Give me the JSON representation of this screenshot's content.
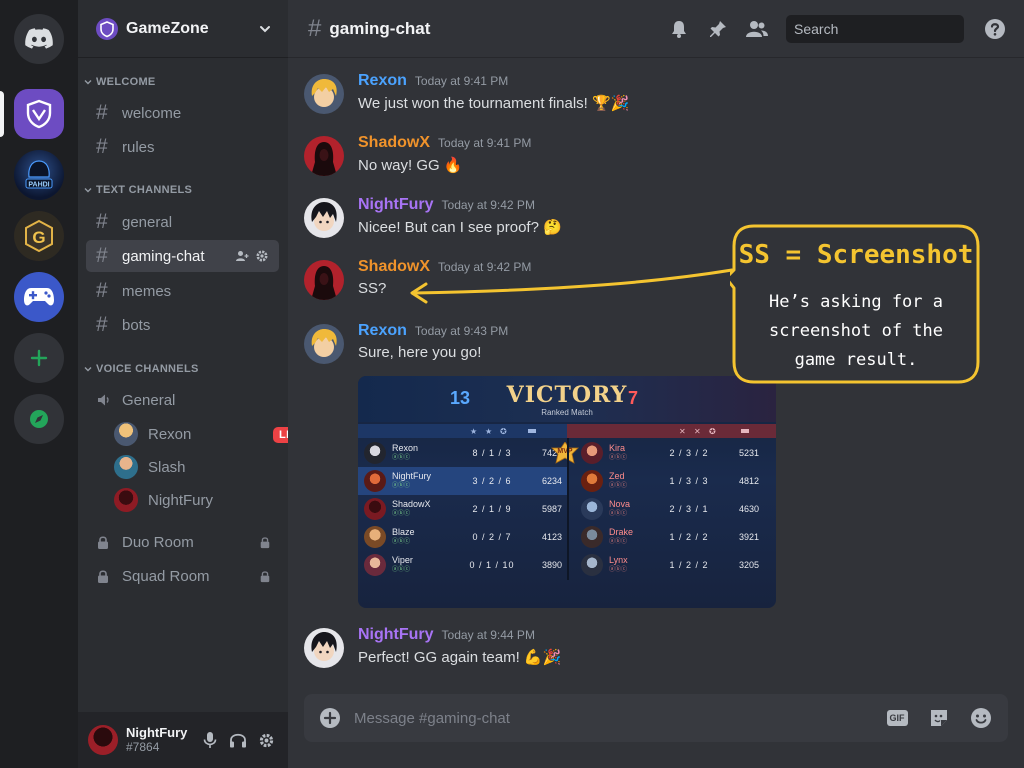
{
  "server": {
    "name": "GameZone"
  },
  "categories": {
    "welcome": "WELCOME",
    "text": "TEXT CHANNELS",
    "voice": "VOICE CHANNELS"
  },
  "channels": {
    "welcome": "welcome",
    "rules": "rules",
    "general": "general",
    "gaming_chat": "gaming-chat",
    "memes": "memes",
    "bots": "bots"
  },
  "voice": {
    "general": "General",
    "users": [
      {
        "name": "Rexon",
        "badge": "LIVE"
      },
      {
        "name": "Slash"
      },
      {
        "name": "NightFury"
      }
    ],
    "duo_room": "Duo Room",
    "squad_room": "Squad Room"
  },
  "user_panel": {
    "name": "NightFury",
    "tag": "#7864"
  },
  "topbar": {
    "channel": "gaming-chat",
    "search_placeholder": "Search"
  },
  "messages": [
    {
      "author": "Rexon",
      "time": "Today at 9:41 PM",
      "text": "We just won the tournament finals! 🏆🎉",
      "color": "#4ba3ff"
    },
    {
      "author": "ShadowX",
      "time": "Today at 9:41 PM",
      "text": "No way! GG 🔥",
      "color": "#f0932b"
    },
    {
      "author": "NightFury",
      "time": "Today at 9:42 PM",
      "text": "Nicee! But can I see proof? 🤔",
      "color": "#a874f5"
    },
    {
      "author": "ShadowX",
      "time": "Today at 9:42 PM",
      "text": "SS?",
      "color": "#f0932b"
    },
    {
      "author": "Rexon",
      "time": "Today at 9:43 PM",
      "text": "Sure, here you go!",
      "color": "#4ba3ff"
    },
    {
      "author": "NightFury",
      "time": "Today at 9:44 PM",
      "text": "Perfect! GG again team! 💪🎉",
      "color": "#a874f5"
    }
  ],
  "scoreboard": {
    "title": "VICTORY",
    "subtitle": "Ranked Match",
    "blue_score": "13",
    "red_score": "7",
    "mvp": "MVP",
    "blue": [
      {
        "name": "Rexon",
        "kda": "8 / 1 / 3",
        "gold": "7421"
      },
      {
        "name": "NightFury",
        "kda": "3 / 2 / 6",
        "gold": "6234"
      },
      {
        "name": "ShadowX",
        "kda": "2 / 1 / 9",
        "gold": "5987"
      },
      {
        "name": "Blaze",
        "kda": "0 / 2 / 7",
        "gold": "4123"
      },
      {
        "name": "Viper",
        "kda": "0 / 1 / 10",
        "gold": "3890"
      }
    ],
    "red": [
      {
        "name": "Kira",
        "kda": "2 / 3 / 2",
        "gold": "5231"
      },
      {
        "name": "Zed",
        "kda": "1 / 3 / 3",
        "gold": "4812"
      },
      {
        "name": "Nova",
        "kda": "2 / 3 / 1",
        "gold": "4630"
      },
      {
        "name": "Drake",
        "kda": "1 / 2 / 2",
        "gold": "3921"
      },
      {
        "name": "Lynx",
        "kda": "1 / 2 / 2",
        "gold": "3205"
      }
    ]
  },
  "callout": {
    "title": "SS = Screenshot",
    "body": "He’s asking for a screenshot of the game result."
  },
  "composer": {
    "placeholder": "Message #gaming-chat",
    "gif": "GIF"
  },
  "colors": {
    "accent": "#5865f2",
    "rail_bg": "#1e1f22",
    "sidebar_bg": "#2b2d31",
    "main_bg": "#313338",
    "callout": "#f4c430",
    "live": "#ed4245"
  }
}
